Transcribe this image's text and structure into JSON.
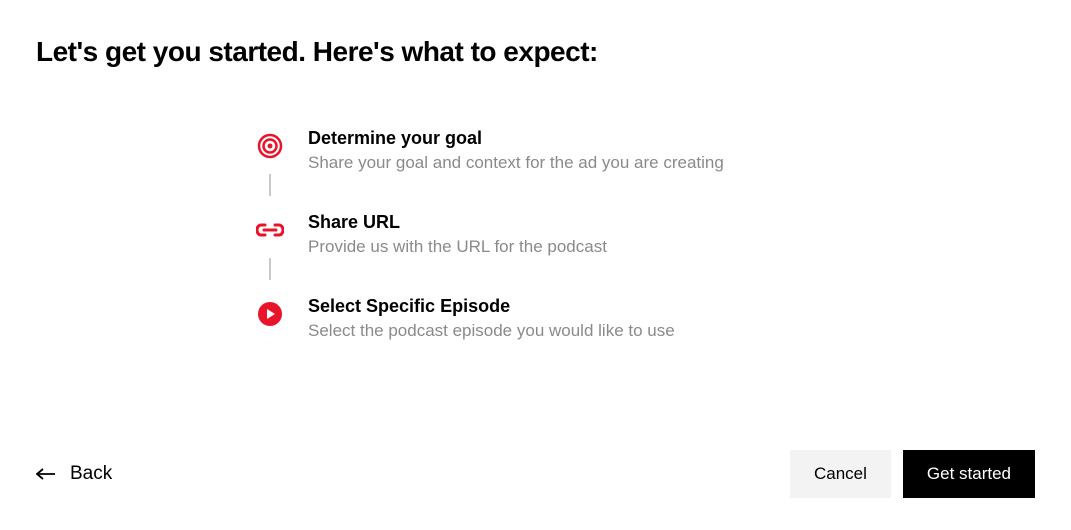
{
  "heading": "Let's get you started. Here's what to expect:",
  "steps": [
    {
      "icon": "target",
      "title": "Determine your goal",
      "desc": "Share your goal and context for the ad you are creating"
    },
    {
      "icon": "link",
      "title": "Share URL",
      "desc": "Provide us with the URL for the podcast"
    },
    {
      "icon": "play",
      "title": "Select Specific Episode",
      "desc": "Select the podcast episode you would like to use"
    }
  ],
  "footer": {
    "back": "Back",
    "cancel": "Cancel",
    "primary": "Get started"
  },
  "colors": {
    "accent": "#e91429"
  }
}
